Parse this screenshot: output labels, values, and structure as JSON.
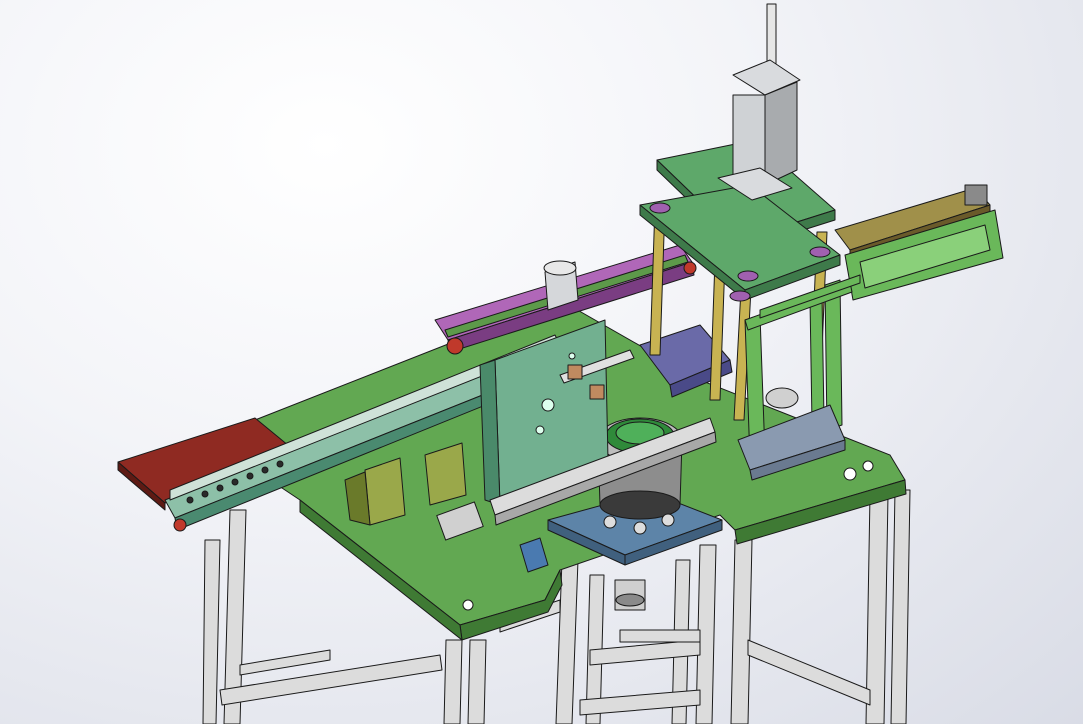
{
  "viewport": {
    "background_top": "#ffffff",
    "background_bottom": "#d9dce6"
  },
  "colors": {
    "table_green": "#5fa04e",
    "table_green_dark": "#3f7a34",
    "frame_gray": "#d8d8d8",
    "frame_gray_dark": "#9a9a9a",
    "plate_teal": "#5fa080",
    "plate_blue": "#5f86a8",
    "belt_red": "#8f2a22",
    "rail_purple": "#a55ab0",
    "bracket_olive": "#8a9a3a",
    "column_gold": "#b8a64a",
    "cylinder_silver": "#c9cccf",
    "conveyor_tan": "#9a8a4a",
    "profile_green": "#6ab85a",
    "bowl_green": "#2f8a3a",
    "bowl_gray": "#8c8c8c"
  }
}
